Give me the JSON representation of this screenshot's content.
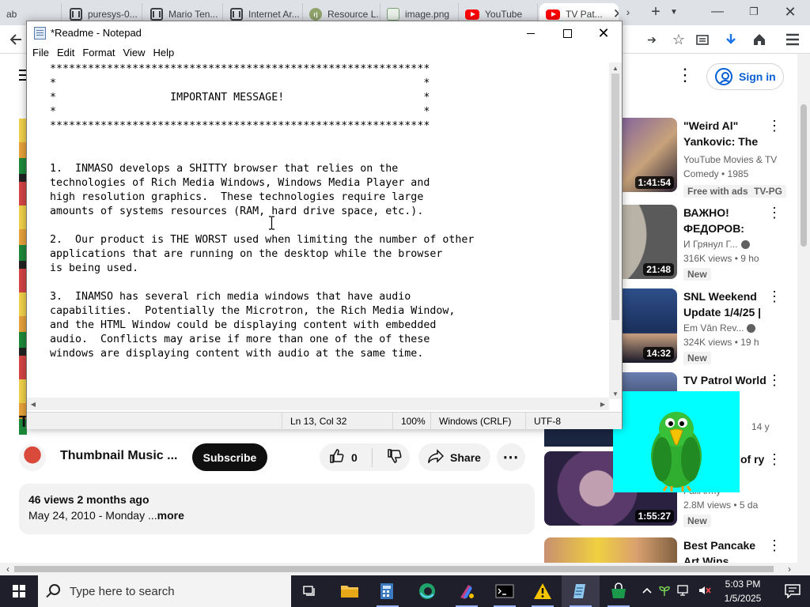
{
  "browser": {
    "tabs": [
      {
        "label": "ab",
        "icon": "page-icon"
      },
      {
        "label": "puresys-0...",
        "icon": "document-icon"
      },
      {
        "label": "Mario Ten...",
        "icon": "document-icon"
      },
      {
        "label": "Internet Ar...",
        "icon": "document-icon"
      },
      {
        "label": "Resource L...",
        "icon": "rj-icon"
      },
      {
        "label": "image.png",
        "icon": "image-icon"
      },
      {
        "label": "YouTube",
        "icon": "youtube-icon"
      },
      {
        "label": "TV Pat...",
        "icon": "youtube-icon",
        "active": true
      }
    ]
  },
  "youtube": {
    "signin_label": "Sign in",
    "video_title_tail": "T",
    "channel_name": "Thumbnail Music ...",
    "subscribe_label": "Subscribe",
    "like_count": "0",
    "share_label": "Share",
    "description": {
      "views": "46 views",
      "age": "2 months ago",
      "date_line": "May 24, 2010 - Monday ...",
      "more": "more"
    },
    "recommendations": [
      {
        "title": "\"Weird Al\" Yankovic: The",
        "channel": "YouTube Movies & TV",
        "meta": "Comedy • 1985",
        "badge1": "Free with ads",
        "badge2": "TV-PG",
        "duration": "1:41:54"
      },
      {
        "title": "ВАЖНО! ФЕДОРОВ:",
        "channel": "И Грянул Г...",
        "meta": "316K views • 9 ho",
        "badge1": "New",
        "duration": "21:48"
      },
      {
        "title": "SNL Weekend Update 1/4/25 |",
        "channel": "Em Vân Rev...",
        "meta": "324K views • 19 h",
        "badge1": "New",
        "duration": "14:32"
      },
      {
        "title": "TV Patrol World",
        "channel": "",
        "meta": "14 y",
        "badge1": "",
        "duration": ""
      },
      {
        "title": "of ry",
        "channel": "FailArmy",
        "meta": "2.8M views • 5 da",
        "badge1": "New",
        "duration": "1:55:27"
      },
      {
        "title": "Best Pancake Art Wins",
        "channel": "",
        "meta": "",
        "badge1": "",
        "duration": ""
      }
    ]
  },
  "notepad": {
    "title": "*Readme - Notepad",
    "menu": [
      "File",
      "Edit",
      "Format",
      "View",
      "Help"
    ],
    "content": "************************************************************\n*                                                          *\n*                  IMPORTANT MESSAGE!                      *\n*                                                          *\n************************************************************\n\n\n1.  INMASO develops a SHITTY browser that relies on the\ntechnologies of Rich Media Windows, Windows Media Player and\nhigh resolution graphics.  These technologies require large\namounts of systems resources (RAM, hard drive space, etc.).\n\n2.  Our product is THE WORST used when limiting the number of other\napplications that are running on the desktop while the browser\nis being used.\n\n3.  INAMSO has several rich media windows that have audio\ncapabilities.  Potentially the Microtron, the Rich Media Window,\nand the HTML Window could be displaying content with embedded\naudio.  Conflicts may arise if more than one of the of these\nwindows are displaying content with audio at the same time.",
    "status": {
      "position": "Ln 13, Col 32",
      "zoom": "100%",
      "line_ending": "Windows (CRLF)",
      "encoding": "UTF-8"
    }
  },
  "taskbar": {
    "search_placeholder": "Type here to search",
    "time": "5:03 PM",
    "date": "1/5/2025"
  }
}
